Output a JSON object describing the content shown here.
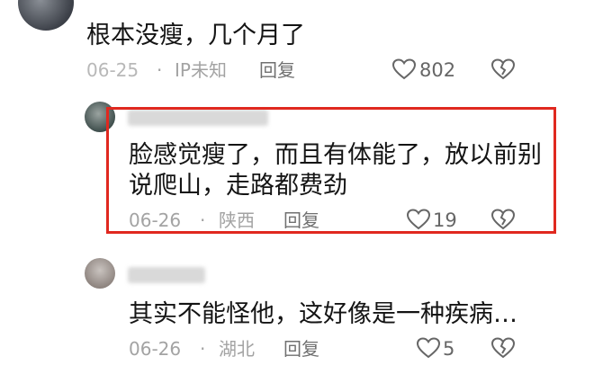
{
  "comments": [
    {
      "text": "根本没瘦，几个月了",
      "date": "06-25",
      "sep": "·",
      "location": "IP未知",
      "reply_label": "回复",
      "likes": "802"
    },
    {
      "text_line1": "脸感觉瘦了，而且有体能了，放以前别",
      "text_line2": "说爬山，走路都费劲",
      "date": "06-26",
      "sep": "·",
      "location": "陕西",
      "reply_label": "回复",
      "likes": "19"
    },
    {
      "text": "其实不能怪他，这好像是一种疾病…",
      "date": "06-26",
      "sep": "·",
      "location": "湖北",
      "reply_label": "回复",
      "likes": "5"
    }
  ],
  "colors": {
    "highlight_border": "#e0281f",
    "meta_text": "#a3a3a3",
    "body_text": "#141414"
  },
  "icons": [
    "heart-icon",
    "broken-heart-icon"
  ]
}
